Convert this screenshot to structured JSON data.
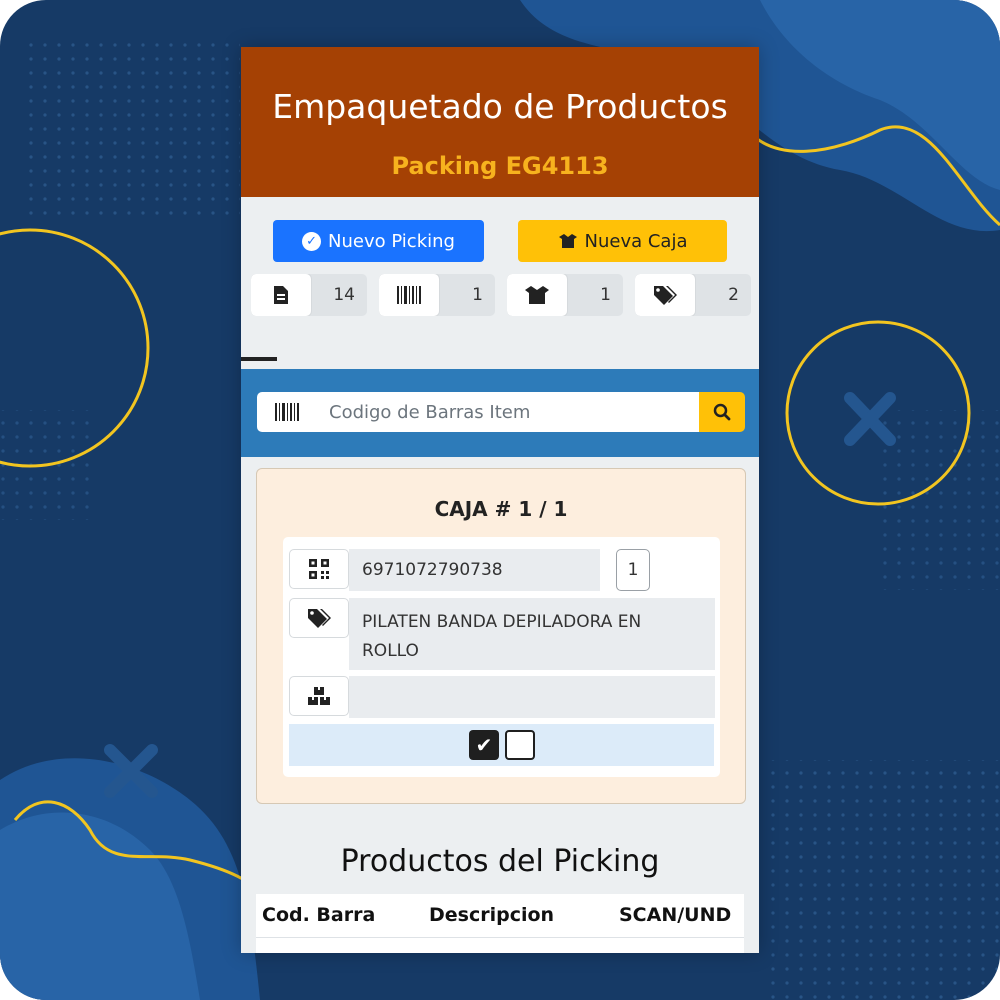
{
  "header": {
    "title": "Empaquetado de Productos",
    "subtitle": "Packing EG4113"
  },
  "actions": {
    "new_picking": "Nuevo Picking",
    "new_box": "Nueva Caja"
  },
  "stats": [
    {
      "icon": "document-icon",
      "value": "14"
    },
    {
      "icon": "barcode-icon",
      "value": "1"
    },
    {
      "icon": "box-open-icon",
      "value": "1"
    },
    {
      "icon": "tags-icon",
      "value": "2"
    }
  ],
  "scan": {
    "placeholder": "Codigo de Barras Item",
    "value": ""
  },
  "box": {
    "title": "CAJA # 1 / 1",
    "barcode": "6971072790738",
    "quantity": "1",
    "product_line1": "PILATEN BANDA DEPILADORA EN",
    "product_line2": "ROLLO",
    "location": "",
    "checkbox_checked": true,
    "checkbox_unchecked": false
  },
  "products": {
    "title": "Productos del Picking",
    "columns": [
      "Cod. Barra",
      "Descripcion",
      "SCAN/UND"
    ]
  },
  "colors": {
    "header_bg": "#a54104",
    "subtitle": "#f7b21e",
    "primary": "#1a73ff",
    "warning": "#ffc107",
    "scanbar": "#2d7bb9",
    "card_bg": "#fdeede",
    "page_bg": "#163a66"
  }
}
